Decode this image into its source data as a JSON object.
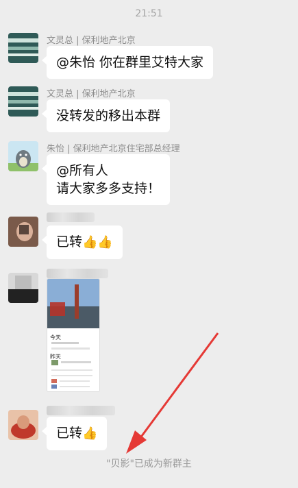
{
  "timestamp": "21:51",
  "messages": [
    {
      "sender": "文灵总 | 保利地产北京",
      "text": "@朱怡 你在群里艾特大家"
    },
    {
      "sender": "文灵总 | 保利地产北京",
      "text": "没转发的移出本群"
    },
    {
      "sender": "朱怡 | 保利地产北京住宅部总经理",
      "line1": "@所有人",
      "line2": "请大家多多支持！"
    },
    {
      "text": "已转",
      "emoji": "👍👍"
    },
    {
      "text": "已转",
      "emoji": "👍"
    }
  ],
  "shared_doc": {
    "label_today": "今天",
    "label_yesterday": "昨天"
  },
  "system_notice": {
    "name": "\"贝影\"",
    "text": "已成为新群主"
  },
  "colors": {
    "background": "#ededed",
    "bubble": "#ffffff",
    "arrow": "#e53935"
  }
}
